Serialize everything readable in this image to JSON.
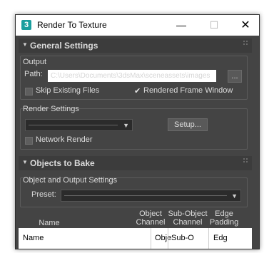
{
  "window": {
    "title": "Render To Texture",
    "app_icon_char": "3",
    "minimize": "—",
    "maximize": "☐",
    "close": "✕"
  },
  "general_settings": {
    "header": "General Settings",
    "output_group": "Output",
    "path_label": "Path:",
    "path_value": "C:\\Users\\Documents\\3dsMax\\sceneassets\\images",
    "browse_button": "...",
    "skip_existing_label": "Skip Existing Files",
    "skip_existing_checked": false,
    "rendered_frame_label": "Rendered Frame Window",
    "rendered_frame_checked": true,
    "render_settings_group": "Render Settings",
    "setup_button": "Setup...",
    "network_render_label": "Network Render",
    "network_render_checked": false
  },
  "objects_to_bake": {
    "header": "Objects to Bake",
    "object_output_group": "Object and Output Settings",
    "preset_label": "Preset:",
    "columns": {
      "name": "Name",
      "object_channel_1": "Object",
      "object_channel_2": "Channel",
      "subobject_channel_1": "Sub-Object",
      "subobject_channel_2": "Channel",
      "edge_padding_1": "Edge",
      "edge_padding_2": "Padding"
    },
    "row": {
      "name": "Name",
      "object_channel": "Obje",
      "subobject_channel": "Sub-O",
      "edge_padding": "Edg"
    }
  },
  "colors": {
    "panel_bg": "#444444",
    "rollout_header_bg": "#3c3c3c",
    "text": "#dcdcdc",
    "app_icon": "#1a9e9e"
  }
}
